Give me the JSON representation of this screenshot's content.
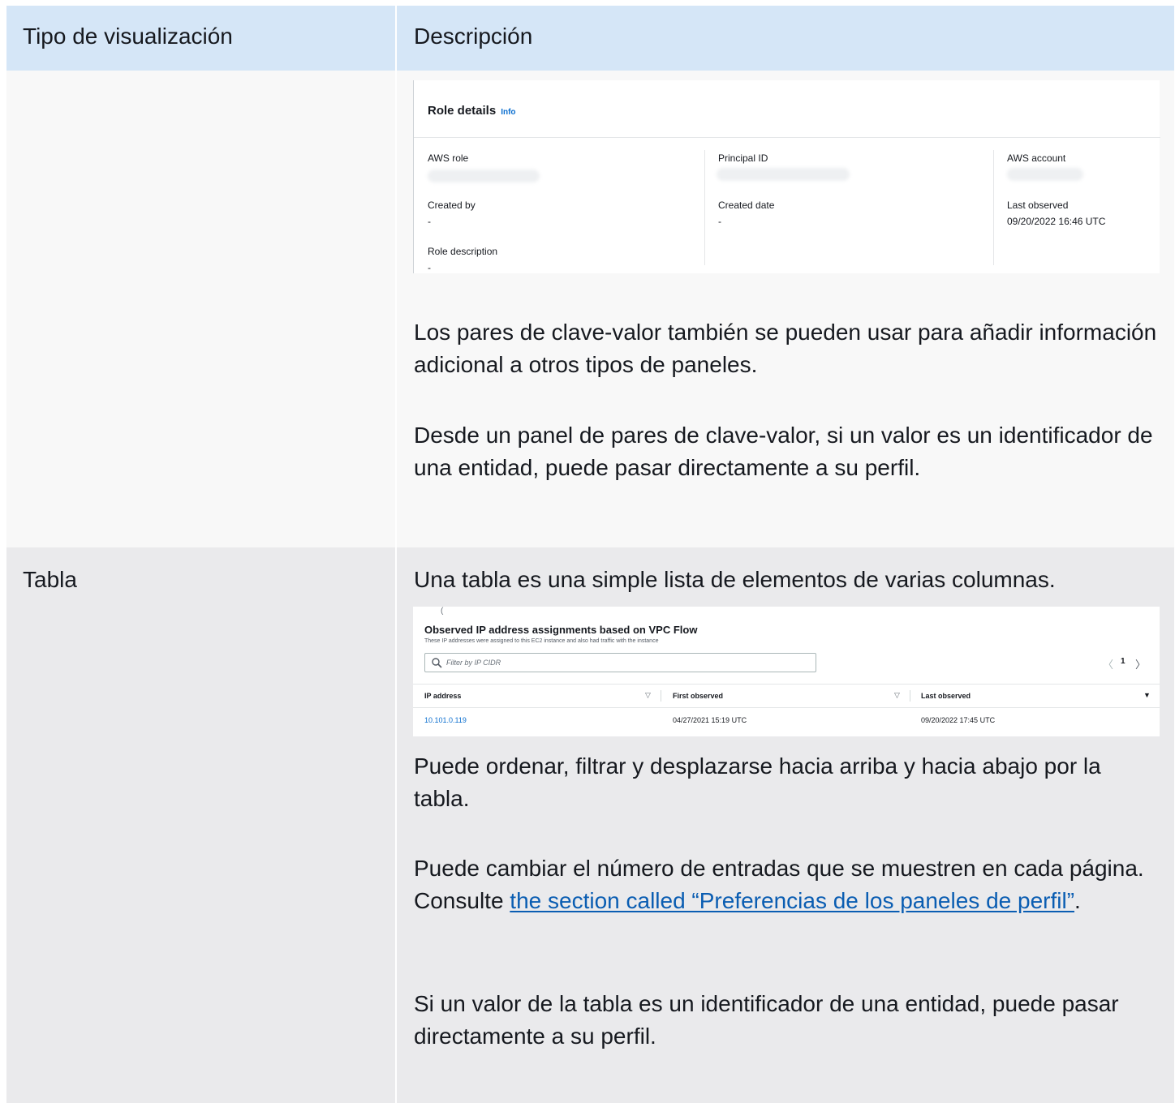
{
  "table": {
    "headers": {
      "type": "Tipo de visualización",
      "description": "Descripción"
    },
    "rows": [
      {
        "type": "",
        "role_details": {
          "title": "Role details",
          "info": "Info",
          "fields": {
            "aws_role_label": "AWS role",
            "principal_id_label": "Principal ID",
            "aws_account_label": "AWS account",
            "created_by_label": "Created by",
            "created_by_value": "-",
            "created_date_label": "Created date",
            "created_date_value": "-",
            "last_observed_label": "Last observed",
            "last_observed_value": "09/20/2022 16:46 UTC",
            "role_description_label": "Role description",
            "role_description_value": "-"
          }
        },
        "paragraphs": [
          "Los pares de clave-valor también se pueden usar para añadir información adicional a otros tipos de paneles.",
          "Desde un panel de pares de clave-valor, si un valor es un identificador de una entidad, puede pasar directamente a su perfil."
        ]
      },
      {
        "type": "Tabla",
        "intro": "Una tabla es una simple lista de elementos de varias columnas.",
        "ip_table": {
          "tick": "(",
          "title": "Observed IP address assignments based on VPC Flow",
          "subtitle": "These IP addresses were assigned to this EC2 instance and also had traffic with the instance",
          "filter_placeholder": "Filter by IP CIDR",
          "page_prev": "〈",
          "page_current": "1",
          "page_next": "〉",
          "columns": [
            "IP address",
            "First observed",
            "Last observed"
          ],
          "rows": [
            {
              "ip": "10.101.0.119",
              "first": "04/27/2021 15:19 UTC",
              "last": "09/20/2022 17:45 UTC"
            }
          ]
        },
        "p1": "Puede ordenar, filtrar y desplazarse hacia arriba y hacia abajo por la tabla.",
        "p2_prefix": "Puede cambiar el número de entradas que se muestren en cada página. Consulte ",
        "p2_link": "the section called “Preferencias de los paneles de perfil”",
        "p2_suffix": ".",
        "p3": "Si un valor de la tabla es un identificador de una entidad, puede pasar directamente a su perfil."
      }
    ]
  }
}
